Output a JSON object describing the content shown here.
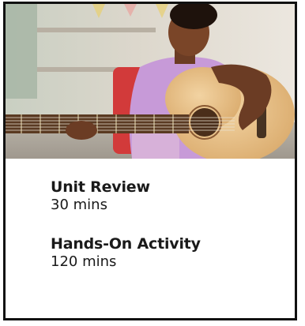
{
  "card": {
    "image": {
      "subject": "child-playing-guitar-photo"
    },
    "items": [
      {
        "title": "Unit Review",
        "duration": "30 mins"
      },
      {
        "title": "Hands-On Activity",
        "duration": "120 mins"
      }
    ]
  },
  "colors": {
    "border": "#111111",
    "text": "#1a1a1a",
    "guitar_body": "#e8c08a",
    "shirt": "#c79ad8"
  }
}
